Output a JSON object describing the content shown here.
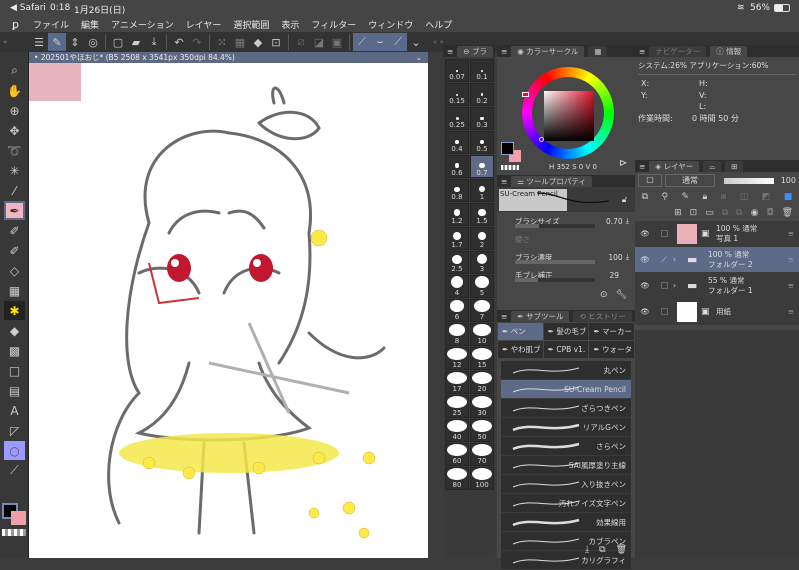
{
  "status_bar": {
    "back_app": "◀ Safari",
    "time": "0:18",
    "date": "1月26日(日)",
    "battery": "56%"
  },
  "menu": [
    "ファイル",
    "編集",
    "アニメーション",
    "レイヤー",
    "選択範囲",
    "表示",
    "フィルター",
    "ウィンドウ",
    "ヘルプ"
  ],
  "canvas_tab": {
    "title": "202501やほおじ* (B5 2508 x 3541px 350dpi 84.4%)"
  },
  "brush_size": {
    "tab": "ブラ",
    "sizes": [
      "0.07",
      "0.1",
      "0.15",
      "0.2",
      "0.25",
      "0.3",
      "0.4",
      "0.5",
      "0.6",
      "0.7",
      "0.8",
      "1",
      "1.2",
      "1.5",
      "1.7",
      "2",
      "2.5",
      "3",
      "4",
      "5",
      "6",
      "7",
      "8",
      "10",
      "12",
      "15",
      "17",
      "20",
      "25",
      "30",
      "40",
      "50",
      "60",
      "70",
      "80",
      "100"
    ],
    "selected": "0.7"
  },
  "color_circle": {
    "tab": "カラーサークル",
    "h": "352",
    "s": "0",
    "v": "0",
    "main_color": "#000000",
    "sub_color": "#f0a0aa"
  },
  "tool_property": {
    "tab": "ツールプロパティ",
    "brush_name": "SU-Cream Pencil",
    "brush_size_label": "ブラシサイズ",
    "brush_size": "0.70",
    "hardness_label": "硬さ",
    "density_label": "ブラシ濃度",
    "density": "100",
    "stabilization_label": "手ブレ補正",
    "stabilization": "29"
  },
  "subtool": {
    "tab": "サブツール",
    "history_tab": "ヒストリー",
    "groups": [
      "ペン",
      "髪の毛ブ",
      "マーカー",
      "やわ肌ブ",
      "CPB v1.",
      "ウォータ"
    ],
    "items": [
      "丸ペン",
      "SU-Cream Pencil",
      "ざらつきペン",
      "リアルGペン",
      "さらペン",
      "SAI風厚塗り主線",
      "入り抜きペン",
      "汚れノイズ文字ペン",
      "効果線用",
      "カブラペン",
      "カリグラフィ"
    ],
    "selected": "SU-Cream Pencil"
  },
  "info": {
    "navigator_tab": "ナビゲーター",
    "info_tab": "情報",
    "system": "システム:26%",
    "app": "アプリケーション:60%",
    "x": "X:",
    "y": "Y:",
    "h": "H:",
    "v": "V:",
    "l": "L:",
    "work_time_label": "作業時間:",
    "work_time": "0 時間 50 分"
  },
  "layers": {
    "tab": "レイヤー",
    "blend": "通常",
    "opacity": "100",
    "items": [
      {
        "mode": "100 % 通常",
        "name": "写真 1",
        "type": "image"
      },
      {
        "mode": "100 % 通常",
        "name": "フォルダー 2",
        "type": "folder",
        "selected": true
      },
      {
        "mode": "55 % 通常",
        "name": "フォルダー 1",
        "type": "folder"
      },
      {
        "mode": "",
        "name": "用紙",
        "type": "paper"
      }
    ]
  }
}
